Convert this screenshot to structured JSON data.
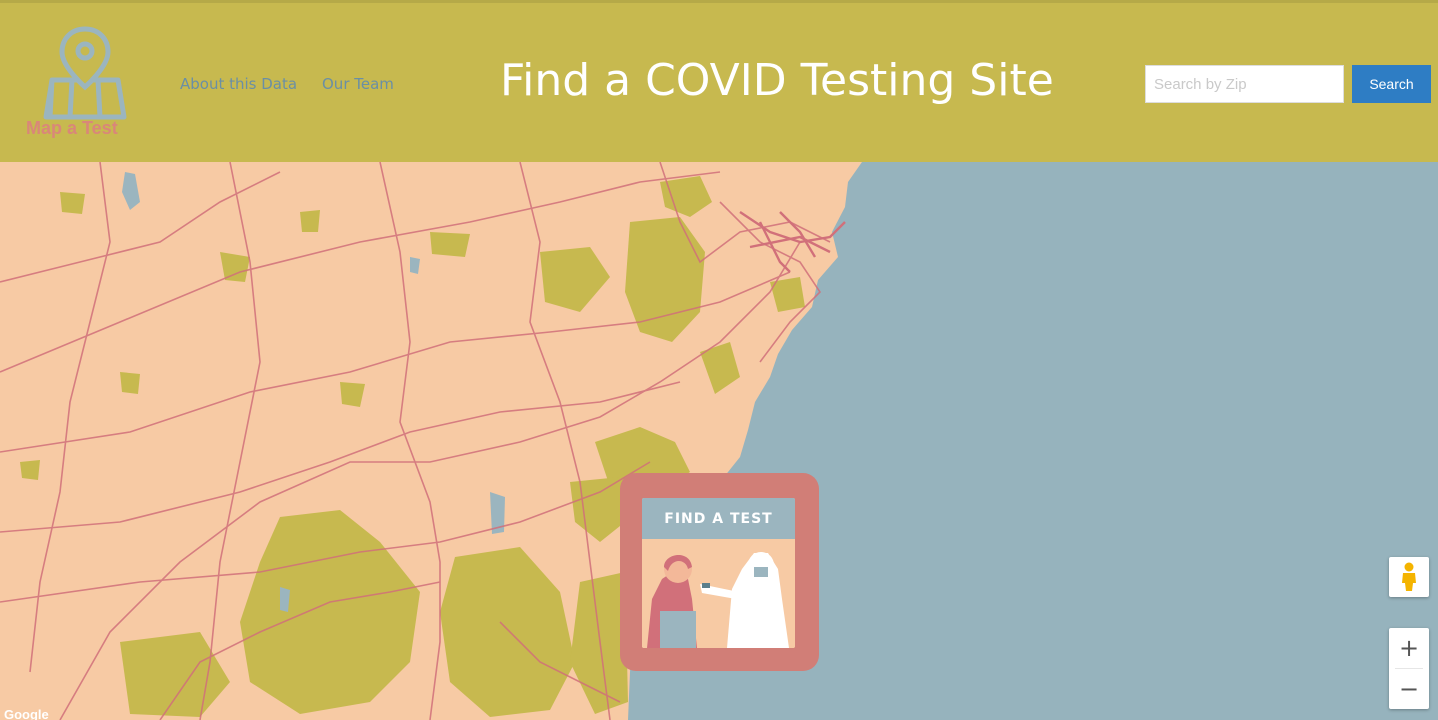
{
  "header": {
    "logo_text": "Map a Test",
    "nav": {
      "about": "About this Data",
      "team": "Our Team"
    },
    "title": "Find a COVID Testing Site",
    "search": {
      "placeholder": "Search by Zip",
      "value": "",
      "button": "Search"
    }
  },
  "map": {
    "card_label": "FIND A TEST",
    "controls": {
      "zoom_in": "+",
      "zoom_out": "−"
    },
    "attribution": "Google",
    "colors": {
      "land": "#f7caa4",
      "water": "#96b3bd",
      "parks": "#c7b94f",
      "roads": "#d1707a",
      "accent": "#d17e77"
    }
  }
}
